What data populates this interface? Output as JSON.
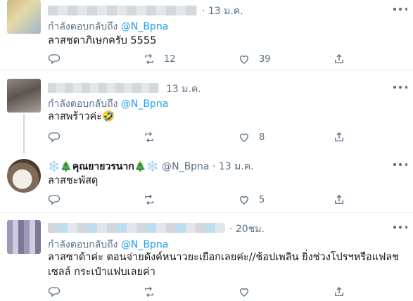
{
  "tweets": [
    {
      "time": "· 13 ม.ค.",
      "reply_prefix": "กำลังตอบกลับถึง",
      "reply_handle": "@N_Bpna",
      "text": "ลาสชดาภิเษกครับ 5555",
      "reply_count": "",
      "retweet_count": "12",
      "like_count": "39"
    },
    {
      "time": "13 ม.ค.",
      "reply_prefix": "กำลังตอบกลับถึง",
      "reply_handle": "@N_Bpna",
      "text": "ลาสพร้าวค่ะ🤣",
      "reply_count": "",
      "retweet_count": "",
      "like_count": "8"
    },
    {
      "name": "❄️🎄คุณยายวรนาก🎄❄️",
      "handle": "@N_Bpna",
      "time": "· 13 ม.ค.",
      "text": "ลาสชะพัสดุ",
      "reply_count": "",
      "retweet_count": "",
      "like_count": "5"
    },
    {
      "time": "· 20ชม.",
      "reply_prefix": "กำลังตอบกลับถึง",
      "reply_handle": "@N_Bpna",
      "text_line1": "ลาสซาด้าค่ะ ตอนจ่ายดังค์หนาวยะเยือกเลยค่ะ//ช้อปเพลิน ยิ่งช่วงโปรฯหรือแฟลช",
      "text_line2": "เซลล์ กระเป๋าแฟบเลยค่า",
      "reply_count": "",
      "retweet_count": "",
      "like_count": ""
    }
  ],
  "icons": [
    "reply-icon",
    "retweet-icon",
    "like-icon",
    "share-icon",
    "more-icon"
  ],
  "colors": {
    "link": "#1da1f2",
    "muted": "#5b7083",
    "divider": "#e6ecf0"
  }
}
